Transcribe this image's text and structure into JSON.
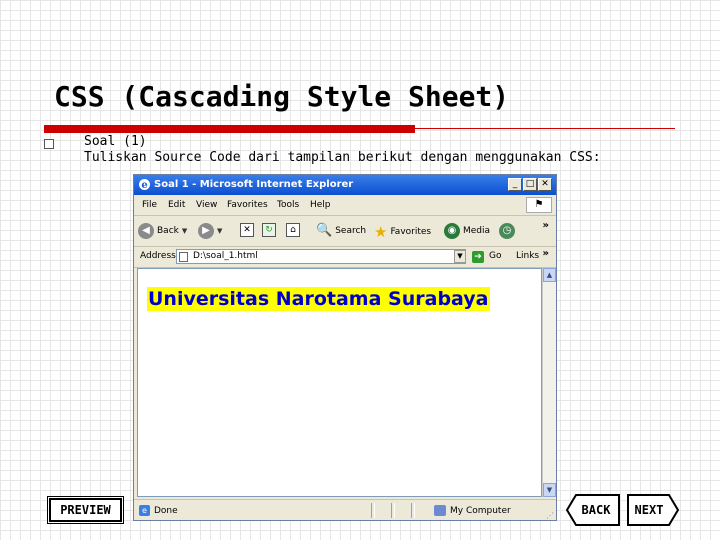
{
  "slide": {
    "title": "CSS (Cascading Style Sheet)",
    "bullet_line1": "Soal (1)",
    "bullet_line2": "Tuliskan Source Code dari tampilan berikut dengan menggunakan CSS:"
  },
  "ie_window": {
    "title": "Soal 1 - Microsoft Internet Explorer",
    "menu": [
      "File",
      "Edit",
      "View",
      "Favorites",
      "Tools",
      "Help"
    ],
    "toolbar": {
      "back": "Back",
      "search": "Search",
      "favorites": "Favorites",
      "media": "Media"
    },
    "address_label": "Address",
    "address_value": "D:\\soal_1.html",
    "go_label": "Go",
    "links_label": "Links",
    "content_heading": "Universitas Narotama Surabaya",
    "status_text": "Done",
    "zone_text": "My Computer"
  },
  "nav": {
    "preview": "PREVIEW",
    "back": "BACK",
    "next": "NEXT"
  },
  "colors": {
    "accent_red": "#cc0000",
    "heading_text": "#0000cc",
    "heading_highlight": "#ffff00"
  }
}
